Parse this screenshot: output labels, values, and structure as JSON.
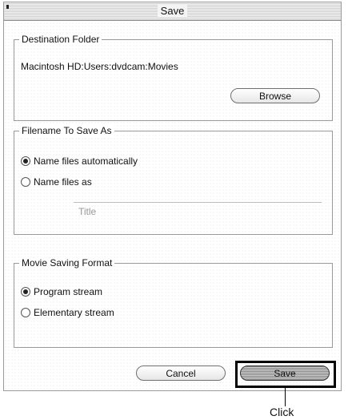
{
  "window": {
    "title": "Save"
  },
  "destination": {
    "group_label": "Destination Folder",
    "path": "Macintosh HD:Users:dvdcam:Movies",
    "browse_label": "Browse"
  },
  "filename": {
    "group_label": "Filename To Save As",
    "options": [
      {
        "label": "Name files automatically",
        "selected": true
      },
      {
        "label": "Name files as",
        "selected": false
      }
    ],
    "field_placeholder": "Title"
  },
  "format": {
    "group_label": "Movie Saving Format",
    "options": [
      {
        "label": "Program stream",
        "selected": true
      },
      {
        "label": "Elementary stream",
        "selected": false
      }
    ]
  },
  "actions": {
    "cancel_label": "Cancel",
    "save_label": "Save"
  },
  "annotation": {
    "label": "Click"
  }
}
